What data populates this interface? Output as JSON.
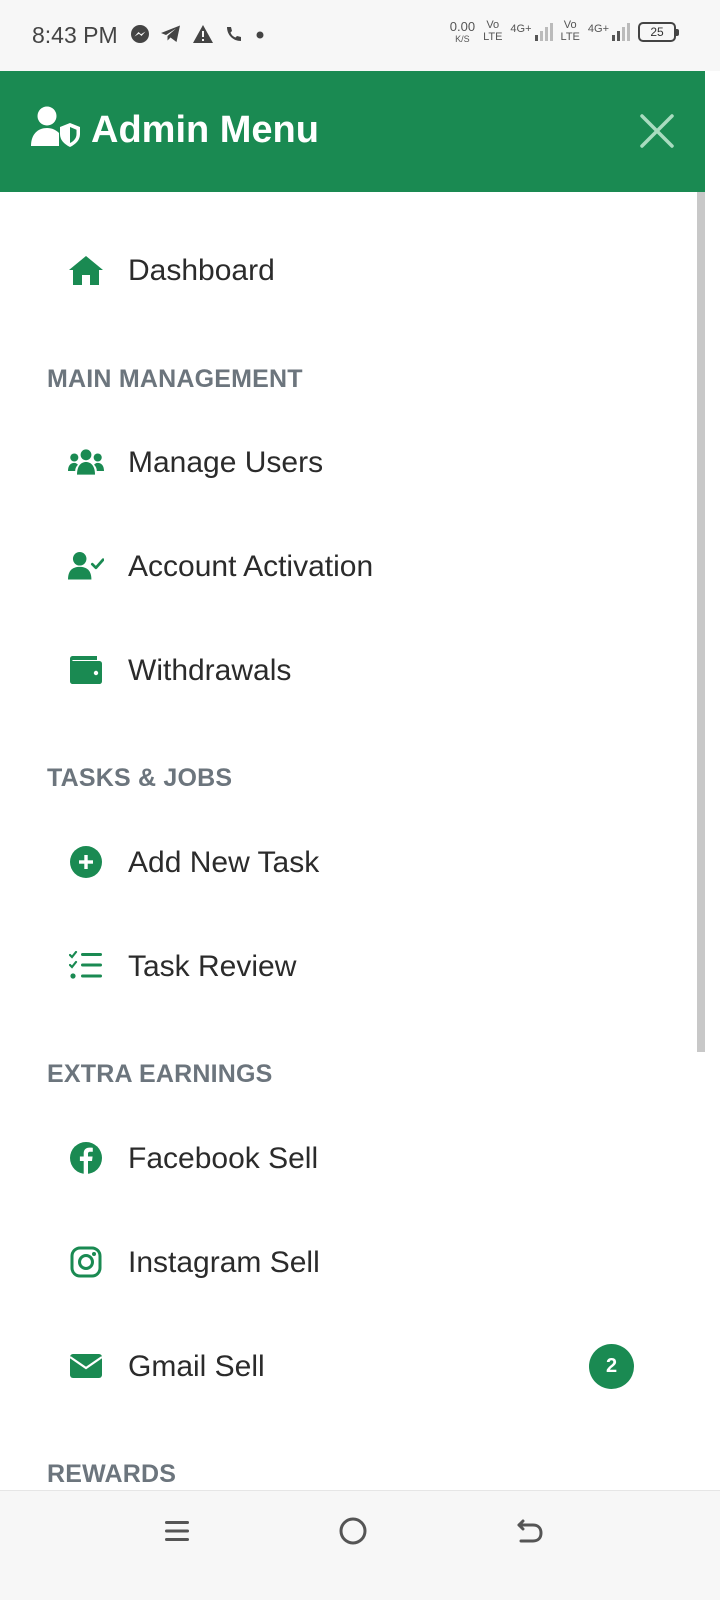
{
  "status_bar": {
    "time": "8:43 PM",
    "net_speed": "0.00",
    "net_unit": "K/S",
    "sim1_volte": [
      "Vo",
      "LTE"
    ],
    "sim1_network": "4G+",
    "sim2_volte": [
      "Vo",
      "LTE"
    ],
    "sim2_network": "4G+",
    "battery": "25",
    "notification_icons": [
      "messenger-icon",
      "telegram-icon",
      "warning-icon",
      "wifi-call-icon",
      "dot-icon"
    ]
  },
  "header": {
    "title": "Admin Menu",
    "icon": "user-shield-icon",
    "close_icon": "close-icon"
  },
  "colors": {
    "accent": "#1a8a52",
    "section_title": "#6c757d",
    "text": "#2b2b2b"
  },
  "menu": {
    "dashboard": {
      "label": "Dashboard",
      "icon": "home-icon"
    },
    "sections": [
      {
        "title": "MAIN MANAGEMENT",
        "items": [
          {
            "label": "Manage Users",
            "icon": "users-icon"
          },
          {
            "label": "Account Activation",
            "icon": "user-check-icon"
          },
          {
            "label": "Withdrawals",
            "icon": "wallet-icon"
          }
        ]
      },
      {
        "title": "TASKS & JOBS",
        "items": [
          {
            "label": "Add New Task",
            "icon": "plus-circle-icon"
          },
          {
            "label": "Task Review",
            "icon": "list-check-icon"
          }
        ]
      },
      {
        "title": "EXTRA EARNINGS",
        "items": [
          {
            "label": "Facebook Sell",
            "icon": "facebook-icon"
          },
          {
            "label": "Instagram Sell",
            "icon": "instagram-icon"
          },
          {
            "label": "Gmail Sell",
            "icon": "envelope-icon",
            "badge": "2"
          }
        ]
      },
      {
        "title": "REWARDS",
        "items": []
      }
    ]
  },
  "nav_bar": {
    "buttons": [
      "menu-icon",
      "home-circle-icon",
      "back-icon"
    ]
  }
}
